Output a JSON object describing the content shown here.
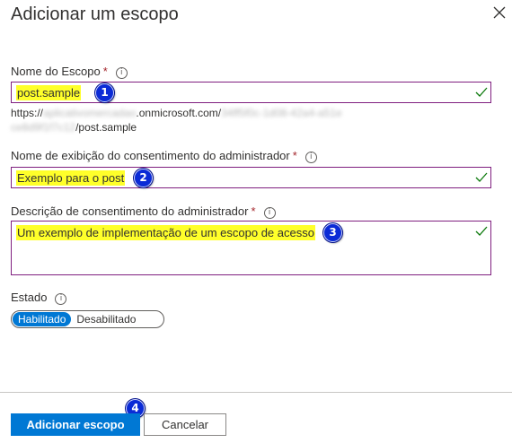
{
  "panel": {
    "title": "Adicionar um escopo"
  },
  "scope_name": {
    "label": "Nome do Escopo",
    "required_mark": "*",
    "value": "post.sample",
    "url_prefix": "https://",
    "url_blurred_1": "aplicativomercadao",
    "url_domain": ".onmicrosoft.com/",
    "url_blurred_2": "34ff5f0c-1d08-42a4-a51e",
    "url_blurred_3": "ce8d9f1f7c12",
    "url_suffix": "/post.sample"
  },
  "consent_name": {
    "label": "Nome de exibição do consentimento do administrador",
    "required_mark": "*",
    "value": "Exemplo para o post"
  },
  "consent_desc": {
    "label": "Descrição de consentimento do administrador",
    "required_mark": "*",
    "value": "Um exemplo de implementação de um escopo de acesso"
  },
  "state": {
    "label": "Estado",
    "option_on": "Habilitado",
    "option_off": "Desabilitado",
    "selected": "Habilitado"
  },
  "badges": {
    "b1": "1",
    "b2": "2",
    "b3": "3",
    "b4": "4"
  },
  "info_glyph": "i",
  "footer": {
    "primary_label": "Adicionar escopo",
    "secondary_label": "Cancelar"
  },
  "colors": {
    "primary": "#0078d4",
    "field_border": "#7f1f7f",
    "highlight": "#ffff2a",
    "badge": "#0b2bd6",
    "valid_check": "#107c10",
    "required": "#a4262c"
  },
  "icons": {
    "close": "close-icon",
    "info": "info-icon",
    "check": "checkmark-icon"
  }
}
